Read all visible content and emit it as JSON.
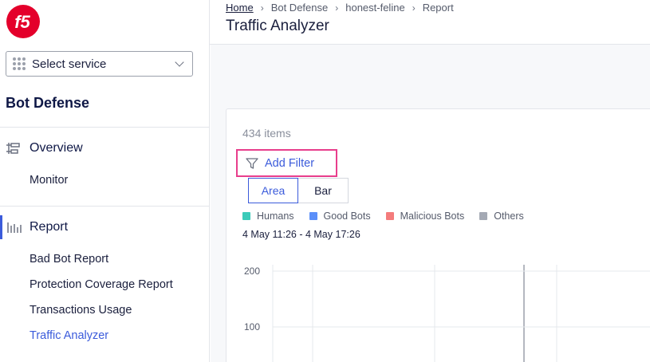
{
  "colors": {
    "brand_red": "#e4002b",
    "accent_blue": "#3b5bdb",
    "highlight_pink": "#e83e8c"
  },
  "sidebar": {
    "service_select": {
      "label": "Select service",
      "icon": "grid-dots-icon"
    },
    "section_title": "Bot Defense",
    "groups": [
      {
        "label": "Overview",
        "icon": "overview-icon",
        "items": [
          "Monitor"
        ]
      },
      {
        "label": "Report",
        "icon": "report-bars-icon",
        "items": [
          "Bad Bot Report",
          "Protection Coverage Report",
          "Transactions Usage",
          "Traffic Analyzer"
        ]
      }
    ],
    "active_item": "Traffic Analyzer"
  },
  "header": {
    "breadcrumb": [
      "Home",
      "Bot Defense",
      "honest-feline",
      "Report"
    ],
    "title": "Traffic Analyzer"
  },
  "main": {
    "items_count": "434 items",
    "add_filter_label": "Add Filter",
    "view_toggle": [
      "Area",
      "Bar"
    ],
    "selected_view": "Area",
    "legend": [
      {
        "label": "Humans",
        "color": "#3ccbb9"
      },
      {
        "label": "Good Bots",
        "color": "#5b8ff9"
      },
      {
        "label": "Malicious Bots",
        "color": "#f47c7c"
      },
      {
        "label": "Others",
        "color": "#a4a9b4"
      }
    ],
    "date_range": "4 May 11:26 - 4 May 17:26",
    "y_ticks": [
      "200",
      "100"
    ]
  }
}
